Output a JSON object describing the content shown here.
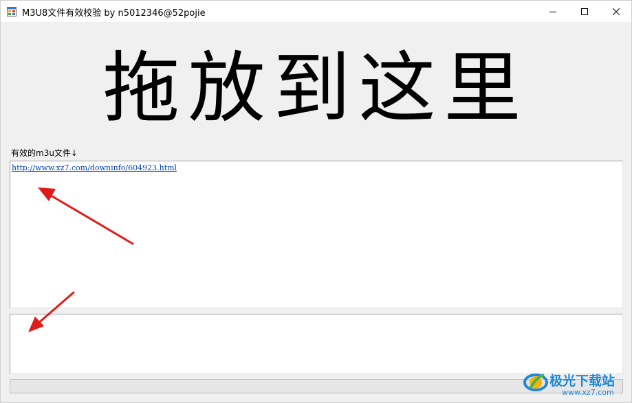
{
  "window": {
    "title": "M3U8文件有效校验 by n5012346@52pojie"
  },
  "main": {
    "drop_hint": "拖放到这里",
    "valid_label": "有效的m3u文件↓",
    "valid_files": [
      "http://www.xz7.com/downinfo/604923.html"
    ],
    "log_text": "",
    "progress": 0
  },
  "watermark": {
    "name": "极光下载站",
    "url": "www.xz7.com"
  },
  "colors": {
    "arrow": "#e01b1b",
    "link": "#0645ad",
    "watermark": "#1e88d8"
  },
  "icons": {
    "app": "app-window-icon",
    "minimize": "minimize-icon",
    "maximize": "maximize-icon",
    "close": "close-icon"
  }
}
